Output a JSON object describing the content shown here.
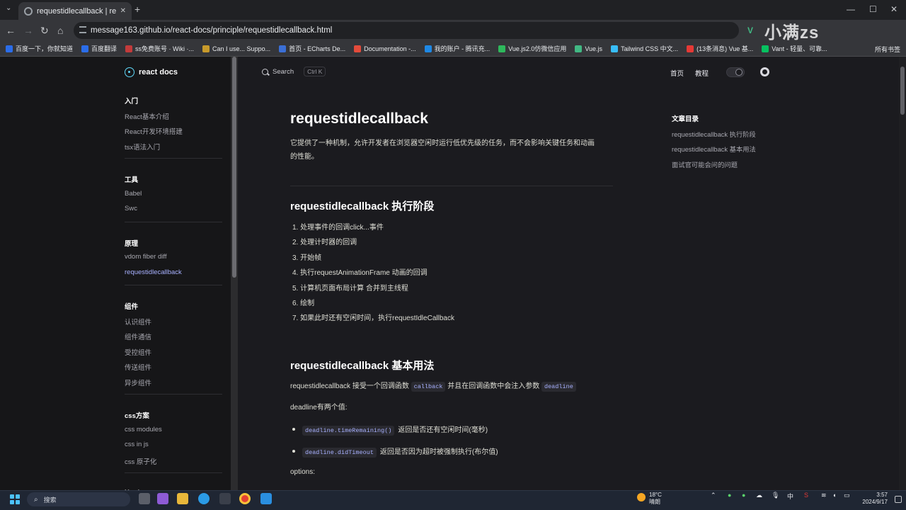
{
  "browser": {
    "tab_title": "requestidlecallback | react do",
    "new_tab": "+",
    "minimize": "—",
    "maximize": "☐",
    "close": "✕",
    "url": "message163.github.io/react-docs/principle/requestidlecallback.html",
    "bookmarks": [
      {
        "label": "百度一下，你就知道",
        "color": "#2b6de9"
      },
      {
        "label": "百度翻译",
        "color": "#2b6de9"
      },
      {
        "label": "ss免费账号 · Wiki ·...",
        "color": "#c23b3b"
      },
      {
        "label": "Can I use... Suppo...",
        "color": "#c79a2b"
      },
      {
        "label": "首页 - ECharts De...",
        "color": "#3b6fd6"
      },
      {
        "label": "Documentation -...",
        "color": "#e34b3b"
      },
      {
        "label": "我的账户 - 腾讯充...",
        "color": "#1e88e5"
      },
      {
        "label": "Vue.js2.0仿微信应用",
        "color": "#2eb85c"
      },
      {
        "label": "Vue.js",
        "color": "#41b883"
      },
      {
        "label": "Tailwind CSS 中文...",
        "color": "#38bdf8"
      },
      {
        "label": "(13条消息) Vue 基...",
        "color": "#e53935"
      },
      {
        "label": "Vant - 轻量、可靠...",
        "color": "#07c160"
      }
    ],
    "all_bookmarks": "所有书签",
    "watermark": "小满zs"
  },
  "sidebar": {
    "logo": "react docs",
    "sections": [
      {
        "title": "入门",
        "items": [
          {
            "label": "React基本介绍",
            "active": false
          },
          {
            "label": "React开发环境搭建",
            "active": false
          },
          {
            "label": "tsx语法入门",
            "active": false
          }
        ]
      },
      {
        "title": "工具",
        "items": [
          {
            "label": "Babel",
            "active": false
          },
          {
            "label": "Swc",
            "active": false
          }
        ]
      },
      {
        "title": "原理",
        "items": [
          {
            "label": "vdom fiber diff",
            "active": false
          },
          {
            "label": "requestidlecallback",
            "active": true
          }
        ]
      },
      {
        "title": "组件",
        "items": [
          {
            "label": "认识组件",
            "active": false
          },
          {
            "label": "组件通信",
            "active": false
          },
          {
            "label": "受控组件",
            "active": false
          },
          {
            "label": "传送组件",
            "active": false
          },
          {
            "label": "异步组件",
            "active": false
          }
        ]
      },
      {
        "title": "css方案",
        "items": [
          {
            "label": "css modules",
            "active": false
          },
          {
            "label": "css in js",
            "active": false
          },
          {
            "label": "css 原子化",
            "active": false
          }
        ]
      },
      {
        "title": "Hooks",
        "items": []
      }
    ]
  },
  "header": {
    "search_label": "Search",
    "search_shortcut": "Ctrl K",
    "nav": [
      "首页",
      "教程"
    ]
  },
  "article": {
    "title": "requestidlecallback",
    "intro_line1": "它提供了一种机制，允许开发者在浏览器空闲时运行低优先级的任务，而不会影响关键任务和动画",
    "intro_line2": "的性能。",
    "section1_title": "requestidlecallback 执行阶段",
    "steps": [
      "1. 处理事件的回调click...事件",
      "2. 处理计时器的回调",
      "3. 开始帧",
      "4. 执行requestAnimationFrame 动画的回调",
      "5. 计算机页面布局计算 合并到主线程",
      "6. 绘制",
      "7. 如果此时还有空闲时间，执行requestIdleCallback"
    ],
    "section2_title": "requestidlecallback 基本用法",
    "usage_before": "requestidlecallback 接受一个回调函数",
    "usage_code1": "callback",
    "usage_middle": "并且在回调函数中会注入参数",
    "usage_code2": "deadline",
    "deadline_intro": "deadline有两个值:",
    "bullets": [
      {
        "code": "deadline.timeRemaining()",
        "text": "返回是否还有空闲时间(毫秒)"
      },
      {
        "code": "deadline.didTimeout",
        "text": "返回是否因为超时被强制执行(布尔值)"
      }
    ],
    "options_label": "options:"
  },
  "toc": {
    "title": "文章目录",
    "items": [
      "requestidlecallback 执行阶段",
      "requestidlecallback 基本用法",
      "面试官可能会问的问题"
    ]
  },
  "taskbar": {
    "search": "搜索",
    "weather_temp": "18°C",
    "weather_desc": "晴朗",
    "ime": "中",
    "time": "3:57",
    "date": "2024/9/17"
  }
}
